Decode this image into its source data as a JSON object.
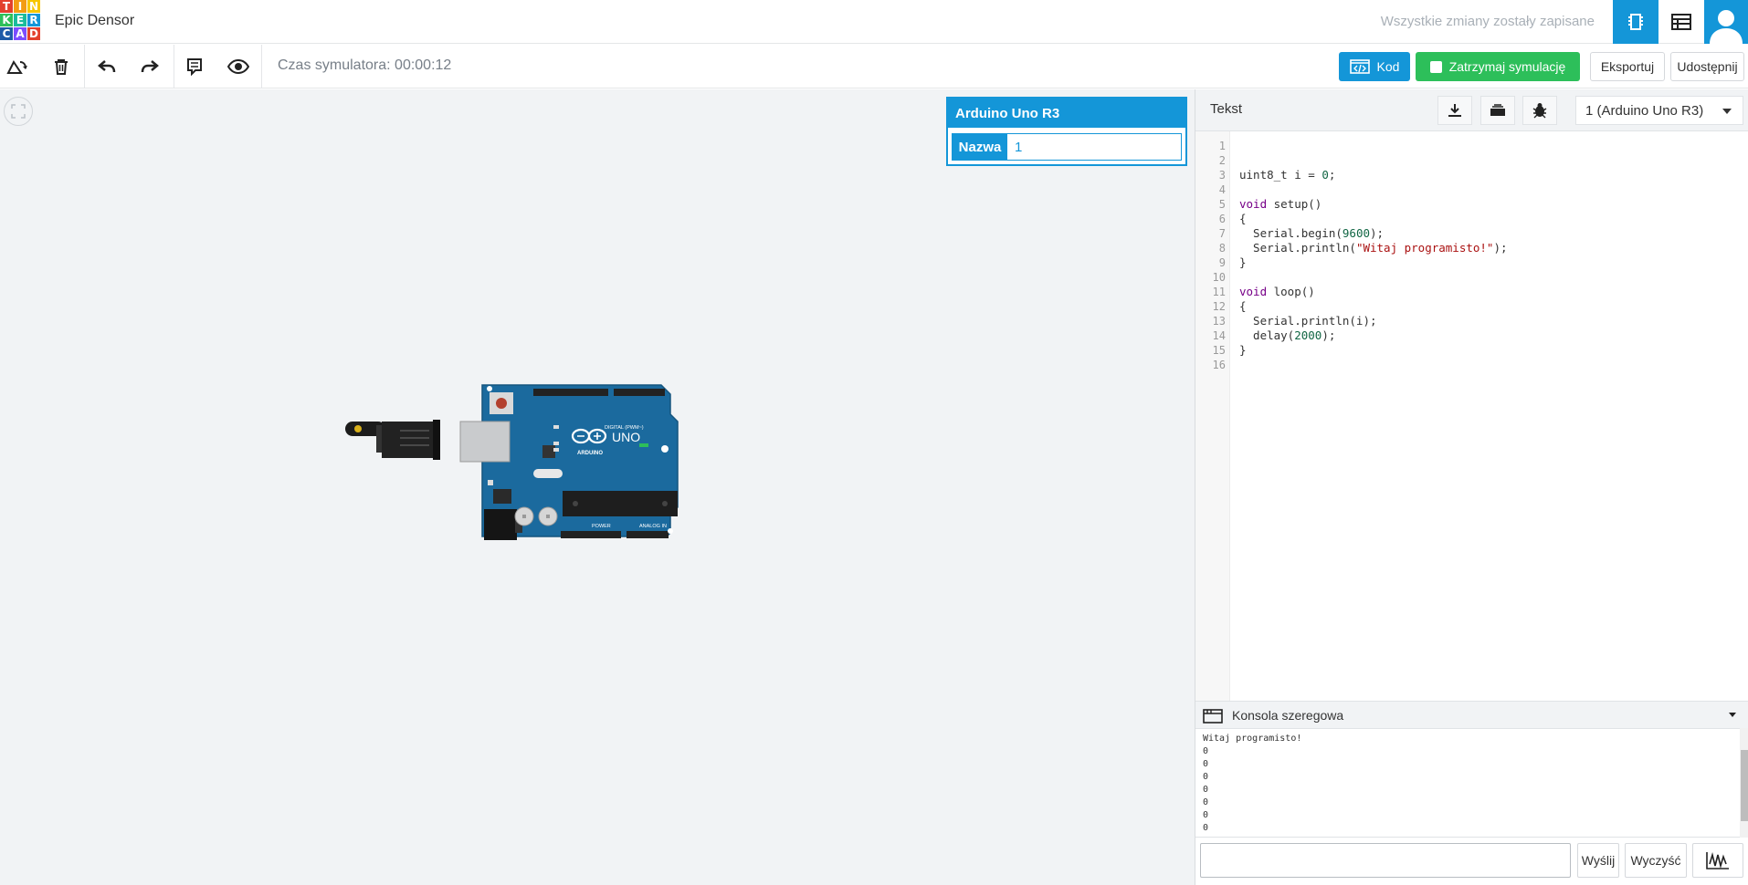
{
  "app": {
    "logo_letters": [
      "T",
      "I",
      "N",
      "K",
      "E",
      "R",
      "C",
      "A",
      "D"
    ],
    "logo_colors": [
      "#e3402d",
      "#f39c12",
      "#f7c600",
      "#2dbf5a",
      "#1abc9c",
      "#1496d8",
      "#1e5aa8",
      "#7c4dff",
      "#e3402d"
    ],
    "project_title": "Epic Densor",
    "save_status": "Wszystkie zmiany zostały zapisane"
  },
  "toolbar": {
    "sim_time": "Czas symulatora: 00:00:12",
    "code_label": "Kod",
    "stop_sim_label": "Zatrzymaj symulację",
    "export_label": "Eksportuj",
    "share_label": "Udostępnij"
  },
  "inspector": {
    "title": "Arduino Uno R3",
    "name_label": "Nazwa",
    "name_value": "1"
  },
  "board": {
    "model_label": "UNO",
    "brand_label": "ARDUINO",
    "digital_label": "DIGITAL (PWM~)",
    "power_label": "POWER",
    "analog_label": "ANALOG IN"
  },
  "code_panel": {
    "mode_label": "Tekst",
    "device_select": "1 (Arduino Uno R3)",
    "line_numbers": [
      "1",
      "2",
      "3",
      "4",
      "5",
      "6",
      "7",
      "8",
      "9",
      "10",
      "11",
      "12",
      "13",
      "14",
      "15",
      "16"
    ]
  },
  "console": {
    "title": "Konsola szeregowa",
    "output_lines": [
      "Witaj programisto!",
      "0",
      "0",
      "0",
      "0",
      "0",
      "0",
      "0"
    ],
    "send_label": "Wyślij",
    "clear_label": "Wyczyść"
  },
  "colors": {
    "accent": "#1496d8",
    "green": "#2dbf5a",
    "board_blue": "#1b6a9e"
  }
}
